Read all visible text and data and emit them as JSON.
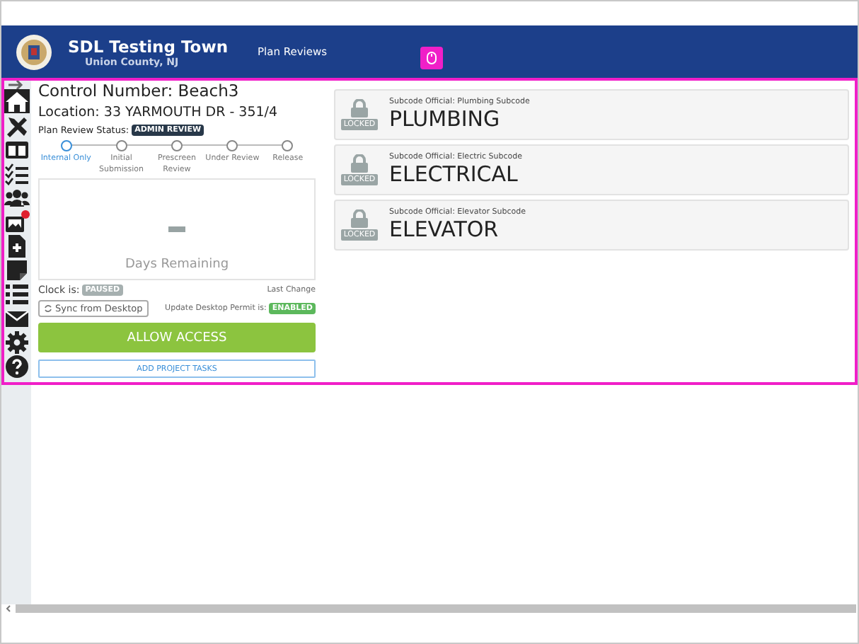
{
  "header": {
    "title": "SDL Testing Town",
    "subtitle": "Union County, NJ",
    "nav": [
      {
        "label": "Plan Reviews"
      }
    ]
  },
  "permit": {
    "control_number": "Control Number: Beach3",
    "location": "Location: 33 YARMOUTH DR - 351/4",
    "status_label": "Plan Review Status:",
    "status": "ADMIN REVIEW",
    "steps": [
      {
        "label": "Internal Only",
        "selected": true
      },
      {
        "label": "Initial Submission",
        "selected": false
      },
      {
        "label": "Prescreen Review",
        "selected": false
      },
      {
        "label": "Under Review",
        "selected": false
      },
      {
        "label": "Release",
        "selected": false
      }
    ],
    "days_label": "Days Remaining",
    "clock_label": "Clock is:",
    "clock_status": "PAUSED",
    "last_change": "Last Change",
    "sync_button": "Sync from Desktop",
    "update_label": "Update Desktop Permit is:",
    "update_status": "ENABLED",
    "allow_button": "ALLOW ACCESS",
    "tasks_button": "ADD PROJECT TASKS"
  },
  "subcodes": [
    {
      "official": "Subcode Official: Plumbing Subcode",
      "name": "PLUMBING",
      "locked": true,
      "lock_label": "LOCKED"
    },
    {
      "official": "Subcode Official: Electric Subcode",
      "name": "ELECTRICAL",
      "locked": true,
      "lock_label": "LOCKED"
    },
    {
      "official": "Subcode Official: Elevator Subcode",
      "name": "ELEVATOR",
      "locked": true,
      "lock_label": "LOCKED"
    }
  ]
}
